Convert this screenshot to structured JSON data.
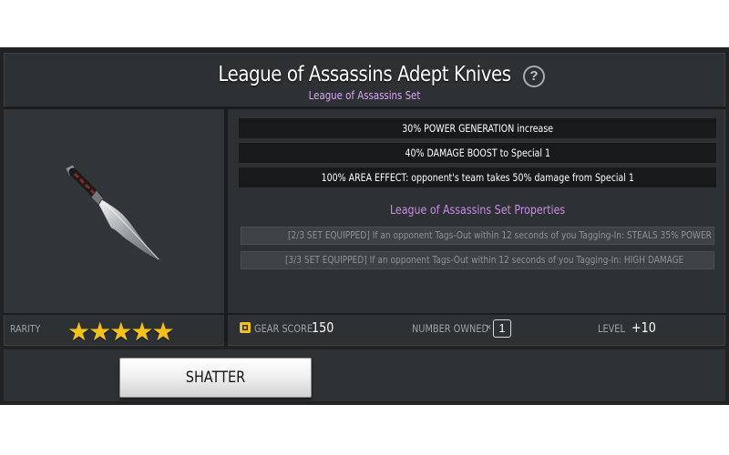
{
  "item": {
    "title": "League of Assassins Adept Knives",
    "set_name": "League of Assassins Set",
    "help_label": "?",
    "image_icon": "curved-knife-icon"
  },
  "stats": [
    "30% POWER GENERATION increase",
    "40% DAMAGE BOOST to Special 1",
    "100% AREA EFFECT: opponent's team takes 50% damage from Special 1"
  ],
  "set_properties": {
    "title": "League of Assassins Set Properties",
    "items": [
      "[2/3 SET EQUIPPED] If an opponent Tags-Out within 12 seconds of you Tagging-In: STEALS 35% POWER",
      "[3/3 SET EQUIPPED] If an opponent Tags-Out within 12 seconds of you Tagging-In: HIGH DAMAGE"
    ]
  },
  "footer": {
    "rarity_label": "RARITY",
    "rarity_stars": 5,
    "gear_score_label": "GEAR SCORE",
    "gear_score_value": "150",
    "number_owned_label": "NUMBER OWNED",
    "number_owned_prefix": "×",
    "number_owned_value": "1",
    "level_label": "LEVEL",
    "level_value": "+10"
  },
  "actions": {
    "shatter_label": "SHATTER"
  },
  "colors": {
    "set_title": "#d9a4f5",
    "set_properties_title": "#c88be8",
    "star": "#f2c21a",
    "gear_icon": "#f2c21a"
  }
}
